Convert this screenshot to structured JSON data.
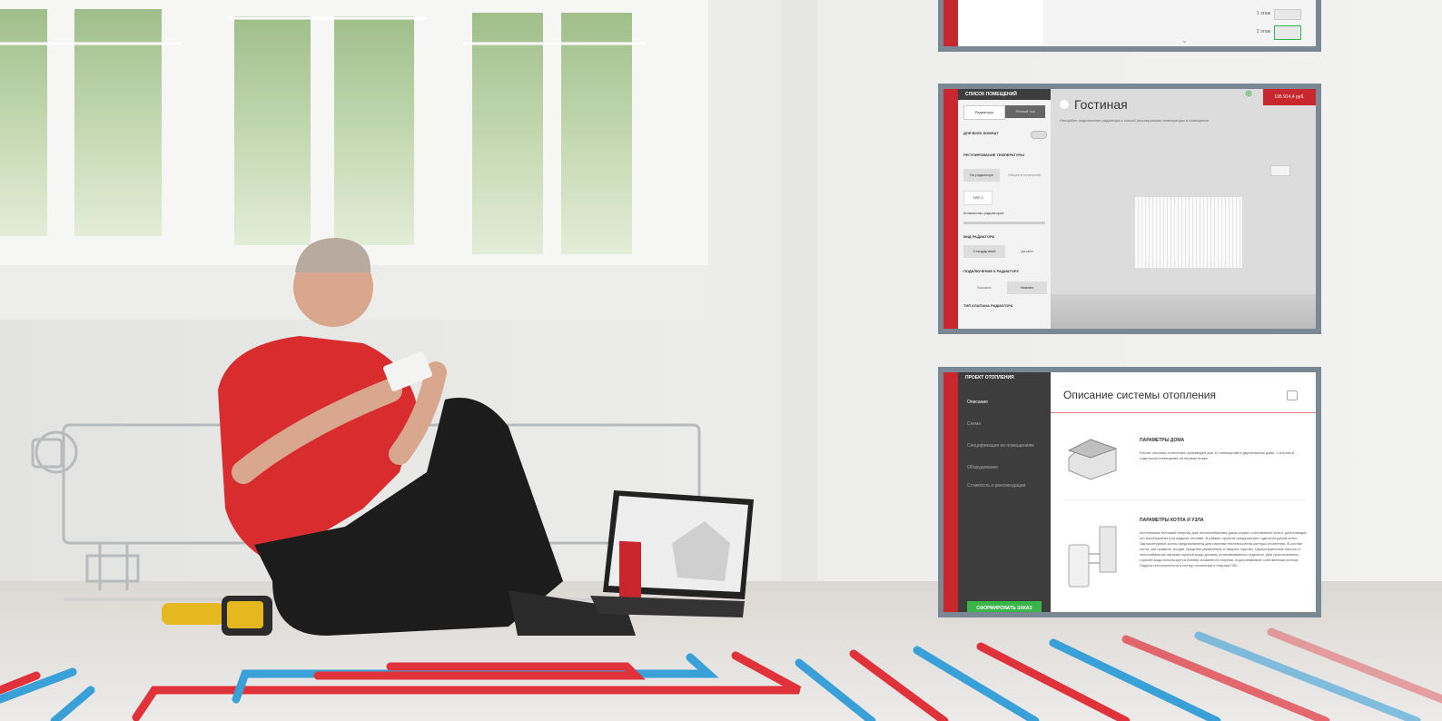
{
  "panel_top": {
    "labels": [
      "1 этаж",
      "2 этаж"
    ]
  },
  "panel_room": {
    "side_header": "СПИСОК ПОМЕЩЕНИЙ",
    "tabs": [
      "Радиаторы",
      "Тёплый пол"
    ],
    "all_rooms": "ДЛЯ ВСЕХ КОМНАТ",
    "temp_control": "РЕГУЛИРОВАНИЕ ТЕМПЕРАТУРЫ",
    "temp_options": [
      "На радиаторе",
      "Общее в котельной"
    ],
    "type_label": "ТИП 1",
    "radiator_count": "Количество радиаторов",
    "radiator_view": "ВИД РАДИАТОРА",
    "view_options": [
      "Стандартный",
      "Дизайн"
    ],
    "connection": "ПОДКЛЮЧЕНИЕ К РАДИАТОРУ",
    "connection_options": [
      "Боковое",
      "Нижнее"
    ],
    "valve_type": "ТИП КЛАПАНА РАДИАТОРА",
    "room_title": "Гостиная",
    "room_subtitle": "Настройте подключение радиатора и способ регулирования температуры в помещении",
    "price": "195 914,4 руб."
  },
  "panel_desc": {
    "side_header": "ПРОЕКТ ОТОПЛЕНИЯ",
    "menu": [
      "Описание",
      "Схема",
      "Спецификация по помещениям",
      "Оборудование",
      "Стоимость и рекомендации"
    ],
    "order_button": "СФОРМИРОВАТЬ ЗАКАЗ",
    "title": "Описание системы отопления",
    "house_heading": "ПАРАМЕТРЫ ДОМА",
    "house_text": "Расчет системы отопления произведен для 10 помещений в двухэтажном доме, с котлом в отдельном помещении на первом этаже.",
    "boiler_heading": "ПАРАМЕТРЫ КОТЛА И УЗЛА",
    "boiler_text": "Источником тепловой энергии для теплоснабжения дома служит собственный котел, работающий на газообразном или жидком топливе. В рамках проекта предусмотрен одноконтурный котел. Одноконтурные котлы предназначены для нагрева теплоносителя контура отопления. В состав котла, как правило, входят средства управления и защиты горелки. Циркуляционные насосы и теплообменник нагрева горячей воды должны устанавливаться отдельно. Для приготовления горячей воды используется бойлер косвенного нагрева, подогреваемый собственным котлом. Подача теплоносителя в контур отопления и нагрева ГВС."
  },
  "colors": {
    "accent_red": "#c8282d",
    "frame_gray": "#7a8893",
    "pipe_red": "#e0323a",
    "pipe_blue": "#3aa0d8"
  }
}
